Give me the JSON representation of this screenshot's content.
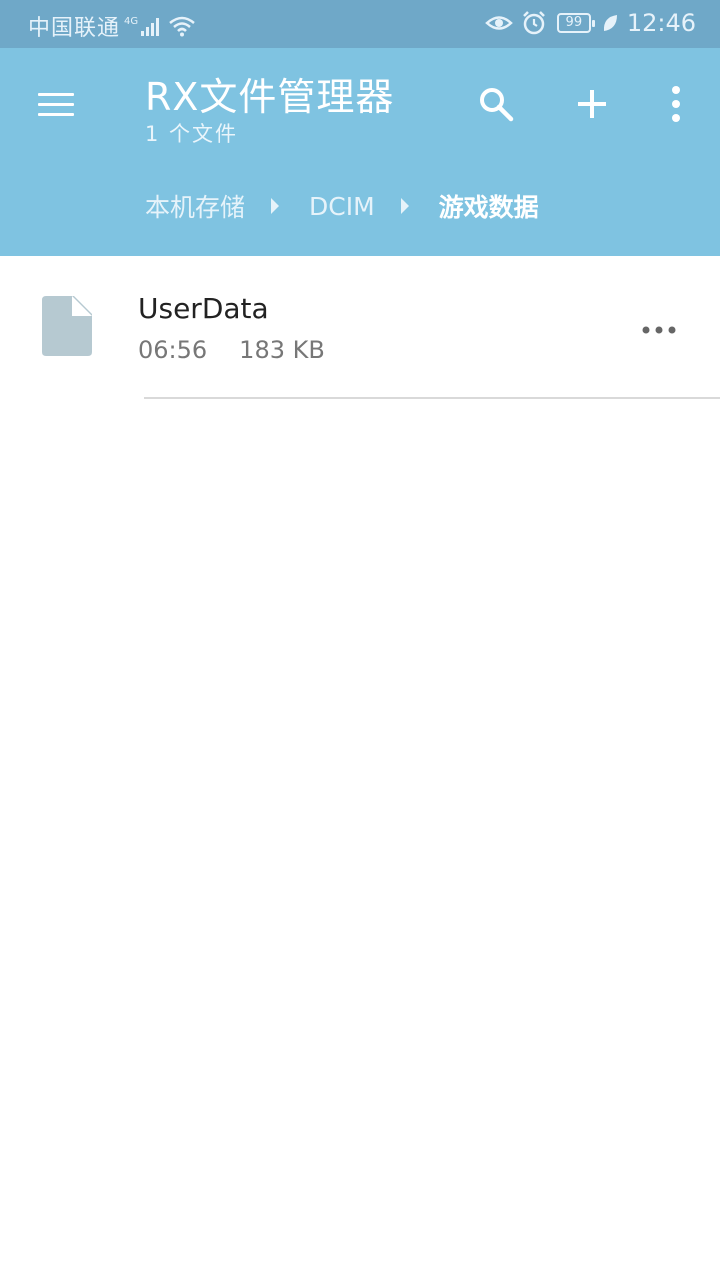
{
  "status_bar": {
    "carrier": "中国联通",
    "network": "4G",
    "battery": "99",
    "time": "12:46",
    "icons": [
      "signal-icon",
      "wifi-icon",
      "eye-icon",
      "alarm-icon",
      "battery-icon",
      "leaf-icon"
    ]
  },
  "app_bar": {
    "title": "RX文件管理器",
    "subtitle": "1 个文件",
    "actions": [
      "menu-icon",
      "search-icon",
      "add-icon",
      "more-vert-icon"
    ],
    "color": "#7fc3e1"
  },
  "breadcrumb": [
    "本机存储",
    "DCIM",
    "游戏数据"
  ],
  "files": [
    {
      "name": "UserData",
      "time": "06:56",
      "size": "183 KB",
      "icon": "file-icon"
    }
  ],
  "colors": {
    "status_bar": "#6fa8c8",
    "file_icon": "#b6c9d1"
  }
}
